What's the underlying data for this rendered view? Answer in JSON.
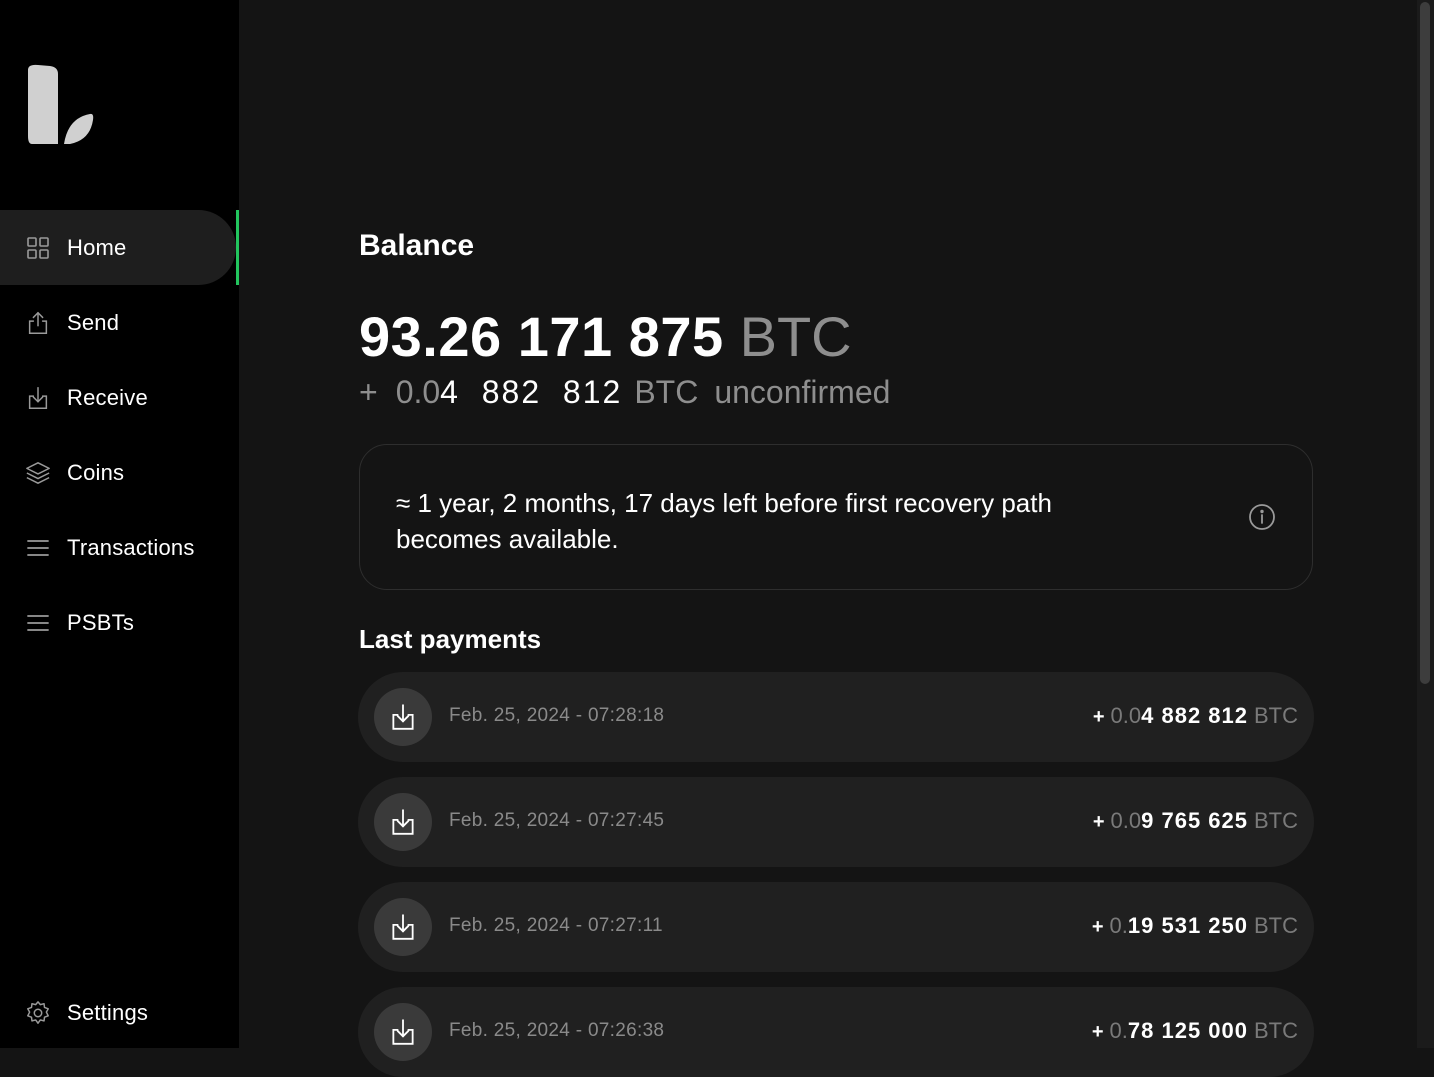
{
  "sidebar": {
    "items": [
      {
        "label": "Home",
        "icon": "grid-icon",
        "active": true
      },
      {
        "label": "Send",
        "icon": "send-icon"
      },
      {
        "label": "Receive",
        "icon": "receive-icon"
      },
      {
        "label": "Coins",
        "icon": "layers-icon"
      },
      {
        "label": "Transactions",
        "icon": "list-icon"
      },
      {
        "label": "PSBTs",
        "icon": "list-icon"
      }
    ],
    "settings_label": "Settings"
  },
  "colors": {
    "accent": "#22c55e",
    "background": "#141414",
    "sidebar": "#000000",
    "row": "#202020",
    "muted": "#8e8e8e"
  },
  "balance": {
    "title": "Balance",
    "amount": "93.26 171 875",
    "unit": "BTC",
    "unconfirmed": {
      "sign": "+",
      "prefix": "0.0",
      "amount": "4  882  812",
      "unit": "BTC",
      "label": "unconfirmed"
    }
  },
  "notice": {
    "text_line1": "≈ 1 year, 2 months, 17 days left before first recovery path",
    "text_line2": "becomes available."
  },
  "payments": {
    "title": "Last payments",
    "rows": [
      {
        "date": "Feb. 25, 2024 - 07:28:18",
        "sign": "+",
        "prefix": "0.0",
        "amount": "4 882 812",
        "unit": "BTC"
      },
      {
        "date": "Feb. 25, 2024 - 07:27:45",
        "sign": "+",
        "prefix": "0.0",
        "amount": "9 765 625",
        "unit": "BTC"
      },
      {
        "date": "Feb. 25, 2024 - 07:27:11",
        "sign": "+",
        "prefix": "0.",
        "amount": "19 531 250",
        "unit": "BTC"
      },
      {
        "date": "Feb. 25, 2024 - 07:26:38",
        "sign": "+",
        "prefix": "0.",
        "amount": "78 125 000",
        "unit": "BTC"
      }
    ]
  }
}
